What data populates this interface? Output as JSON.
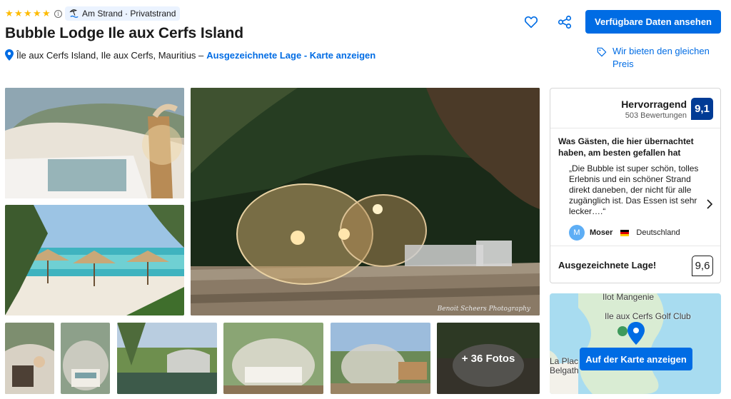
{
  "header": {
    "star_rating": 5,
    "beach_badge": "Am Strand · Privatstrand",
    "title": "Bubble Lodge Ile aux Cerfs Island",
    "address": "Île aux Cerfs Island, Ile aux Cerfs, Mauritius –",
    "location_link": "Ausgezeichnete Lage - Karte anzeigen"
  },
  "actions": {
    "cta_label": "Verfügbare Daten ansehen",
    "price_match": "Wir bieten den gleichen Preis"
  },
  "gallery": {
    "more_photos_label": "+ 36 Fotos",
    "watermark": "Benoit Scheers Photography"
  },
  "reviews": {
    "rating_word": "Hervorragend",
    "review_count": "503 Bewertungen",
    "score": "9,1",
    "liked_label": "Was Gästen, die hier übernachtet haben, am besten gefallen hat",
    "quote": "„Die Bubble ist super schön, tolles Erlebnis und ein schöner Strand direkt daneben, der nicht für alle zugänglich ist. Das Essen ist sehr lecker….“",
    "reviewer_initial": "M",
    "reviewer_name": "Moser",
    "reviewer_country": "Deutschland",
    "location_label": "Ausgezeichnete Lage!",
    "location_score": "9,6"
  },
  "map": {
    "label_top": "Ilot Mangenie",
    "label_golf": "Ile aux Cerfs Golf Club",
    "label_left1": "La Plac",
    "label_left2": "Belgath",
    "button_label": "Auf der Karte anzeigen"
  },
  "colors": {
    "brand_blue": "#006ce4",
    "score_navy": "#003b95",
    "star_yellow": "#febb02"
  }
}
